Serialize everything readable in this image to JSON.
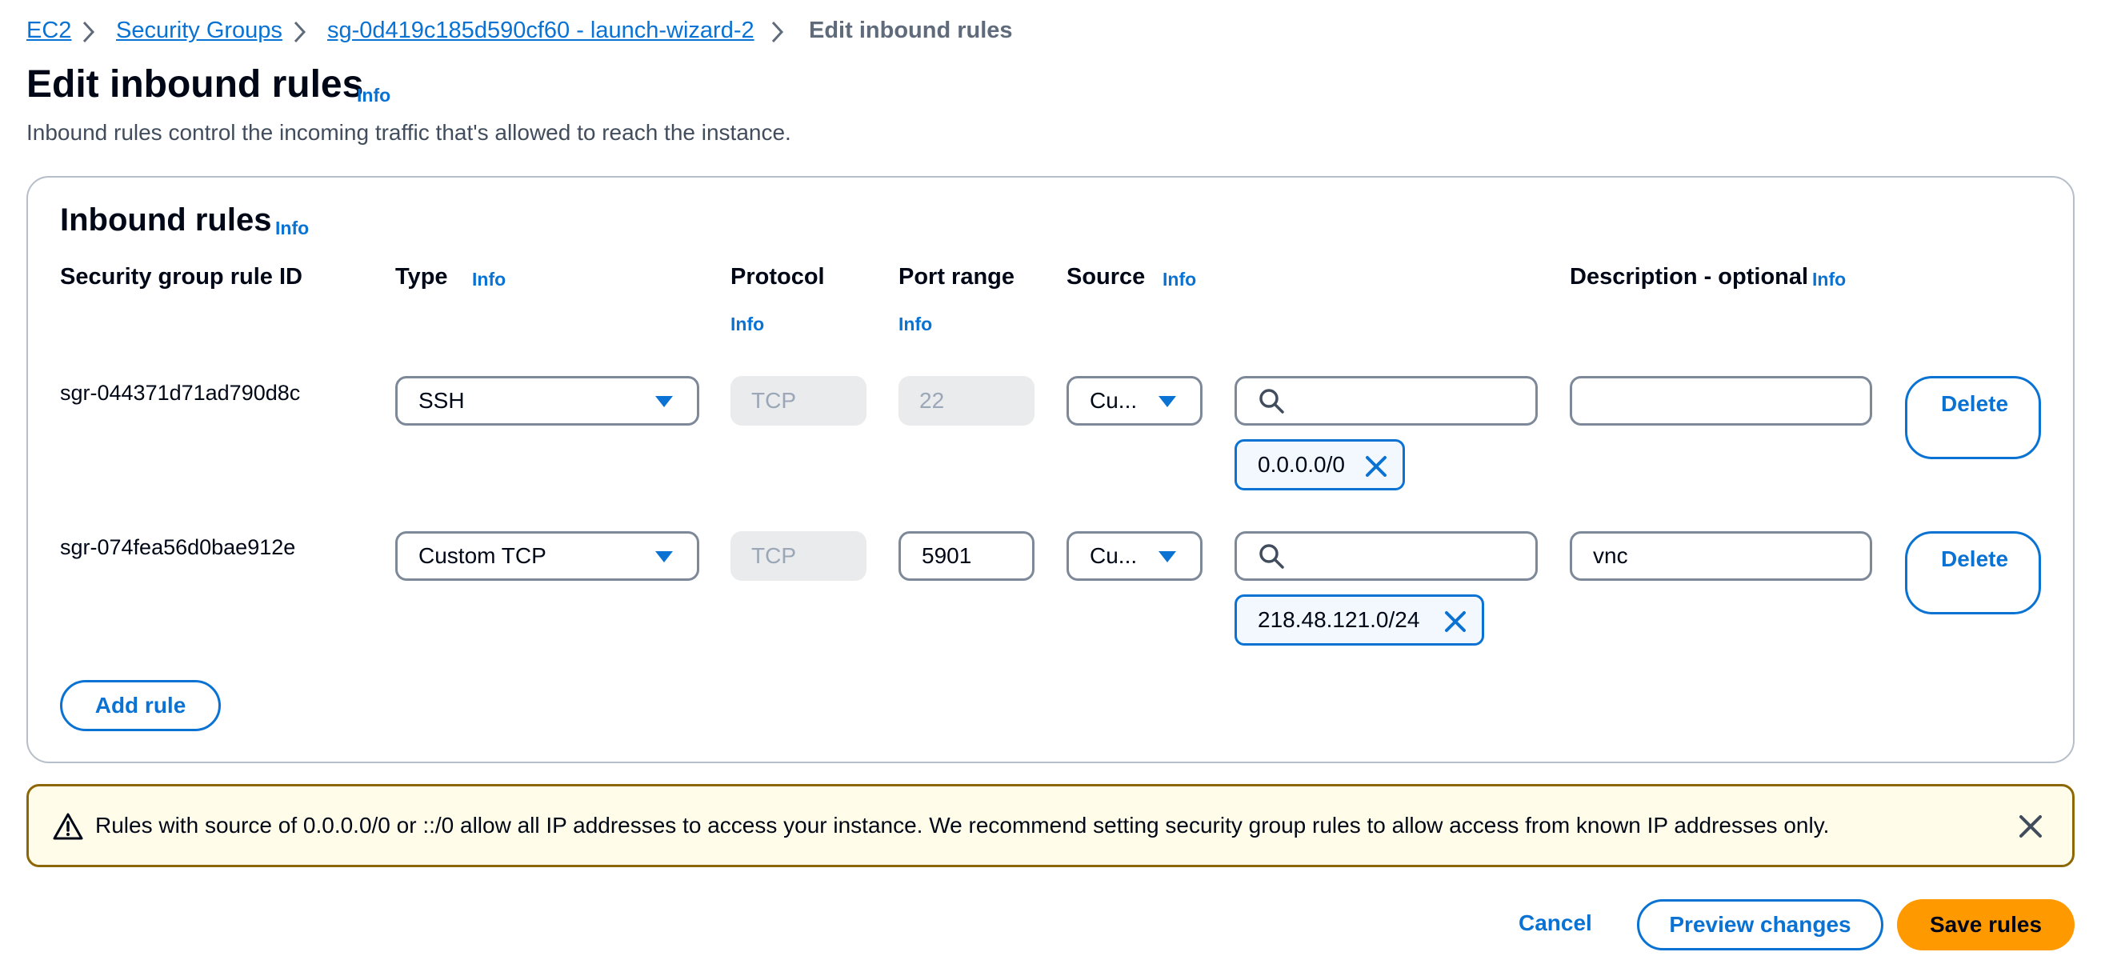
{
  "breadcrumb": {
    "items": [
      "EC2",
      "Security Groups",
      "sg-0d419c185d590cf60 - launch-wizard-2"
    ],
    "current": "Edit inbound rules"
  },
  "page": {
    "title": "Edit inbound rules",
    "info": "Info",
    "description": "Inbound rules control the incoming traffic that's allowed to reach the instance."
  },
  "panel": {
    "title": "Inbound rules",
    "info": "Info",
    "columns": {
      "rule_id": "Security group rule ID",
      "type": "Type",
      "protocol": "Protocol",
      "port_range": "Port range",
      "source": "Source",
      "description": "Description - optional"
    },
    "info_label": "Info",
    "rules": [
      {
        "id": "sgr-044371d71ad790d8c",
        "type": "SSH",
        "protocol": "TCP",
        "port": "22",
        "source_type": "Cu...",
        "source_search": "",
        "cidr": "0.0.0.0/0",
        "description": "",
        "delete_label": "Delete"
      },
      {
        "id": "sgr-074fea56d0bae912e",
        "type": "Custom TCP",
        "protocol": "TCP",
        "port": "5901",
        "source_type": "Cu...",
        "source_search": "",
        "cidr": "218.48.121.0/24",
        "description": "vnc",
        "delete_label": "Delete"
      }
    ],
    "add_rule_label": "Add rule"
  },
  "alert": {
    "text": "Rules with source of 0.0.0.0/0 or ::/0 allow all IP addresses to access your instance. We recommend setting security group rules to allow access from known IP addresses only."
  },
  "footer": {
    "cancel": "Cancel",
    "preview": "Preview changes",
    "save": "Save rules"
  },
  "colors": {
    "link": "#0972d3",
    "primary_button": "#ff9900",
    "warning_border": "#8d6605",
    "warning_bg": "#fffce9"
  },
  "icons": {
    "breadcrumb_separator": "chevron-right-icon",
    "select_arrow": "caret-down-icon",
    "search": "search-icon",
    "remove_token": "close-icon",
    "warning": "warning-icon",
    "dismiss": "close-icon"
  }
}
